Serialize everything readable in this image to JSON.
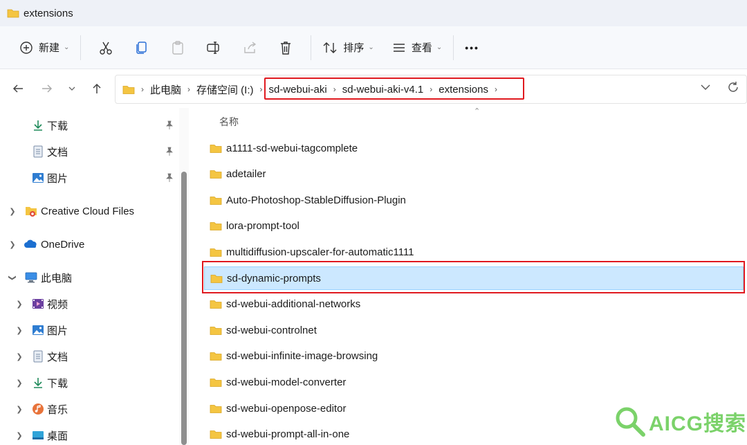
{
  "window": {
    "title": "extensions"
  },
  "toolbar": {
    "new_label": "新建",
    "sort_label": "排序",
    "view_label": "查看",
    "more_label": "•••"
  },
  "breadcrumb": {
    "segments": [
      "此电脑",
      "存储空间 (I:)",
      "sd-webui-aki",
      "sd-webui-aki-v4.1",
      "extensions"
    ]
  },
  "sidebar": {
    "quick": [
      {
        "label": "下载",
        "icon": "download-icon"
      },
      {
        "label": "文档",
        "icon": "document-icon"
      },
      {
        "label": "图片",
        "icon": "pictures-icon"
      }
    ],
    "roots": [
      {
        "label": "Creative Cloud Files",
        "icon": "creative-cloud-icon"
      },
      {
        "label": "OneDrive",
        "icon": "onedrive-icon"
      },
      {
        "label": "此电脑",
        "icon": "this-pc-icon"
      }
    ],
    "pc_children": [
      {
        "label": "视频",
        "icon": "videos-icon"
      },
      {
        "label": "图片",
        "icon": "pictures-icon"
      },
      {
        "label": "文档",
        "icon": "document-icon"
      },
      {
        "label": "下载",
        "icon": "download-icon"
      },
      {
        "label": "音乐",
        "icon": "music-icon"
      },
      {
        "label": "桌面",
        "icon": "desktop-icon"
      }
    ]
  },
  "list": {
    "column_name": "名称",
    "selected_index": 5,
    "items": [
      "a1111-sd-webui-tagcomplete",
      "adetailer",
      "Auto-Photoshop-StableDiffusion-Plugin",
      "lora-prompt-tool",
      "multidiffusion-upscaler-for-automatic1111",
      "sd-dynamic-prompts",
      "sd-webui-additional-networks",
      "sd-webui-controlnet",
      "sd-webui-infinite-image-browsing",
      "sd-webui-model-converter",
      "sd-webui-openpose-editor",
      "sd-webui-prompt-all-in-one"
    ]
  },
  "watermark": {
    "text": "AICG搜索"
  },
  "colors": {
    "selection": "#cce8ff",
    "highlight_box": "#e0191f",
    "folder": "#f4c542",
    "watermark": "#7bd26a"
  }
}
